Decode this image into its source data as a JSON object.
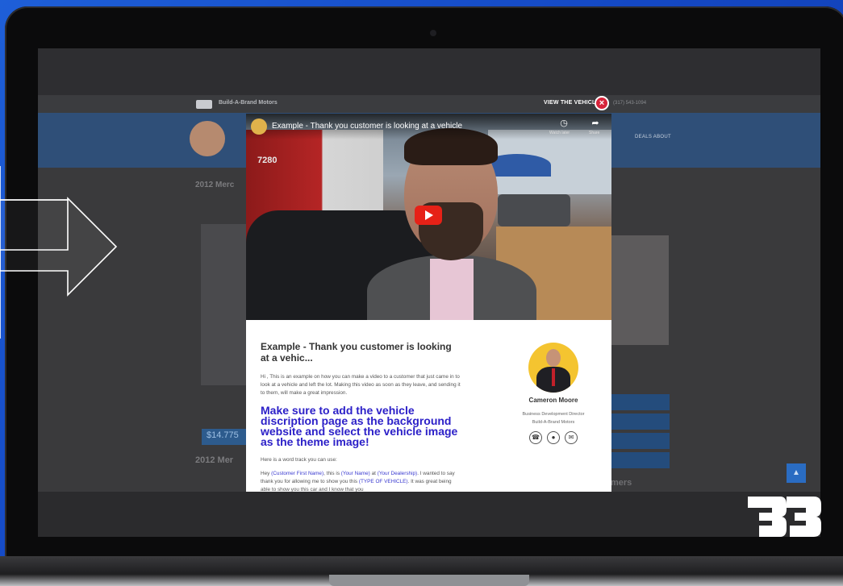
{
  "site": {
    "brand": "Build-A-Brand Motors",
    "page_heading": "2012 Merc",
    "price": "$14.775",
    "heading2": "2012 Mer",
    "nav": "DEALS   ABOUT",
    "phone": "(317) 543-1094",
    "view_vehicle": "VIEW THE VEHICLE",
    "sidebar_heading": "mers"
  },
  "video": {
    "title": "Example - Thank you customer is looking at a vehicle",
    "watch_later_label": "Watch later",
    "share_label": "Share",
    "sign_text": "7280"
  },
  "message": {
    "title": "Example - Thank you customer is looking at a vehic...",
    "body": "Hi , This is an example on how you can make a video to a customer that just came in to look at a vehicle and left the lot. Making this video as soon as they leave, and sending it to them, will make a great impression.",
    "instruction": "Make sure to add the vehicle discription page as the background website and select the vehicle image as the theme image!",
    "word_track_intro": "Here is a word track you can use:",
    "track_1": "Hey ",
    "var_first_name": "(Customer First Name)",
    "track_2": ", this is ",
    "var_your_name": "(Your Name)",
    "track_3": " at ",
    "var_dealership": "(Your Dealership)",
    "track_4": ". I wanted to say thank you for allowing me to show you this ",
    "var_vehicle": "(TYPE OF VEHICLE)",
    "track_5": ". It was great being able to show you this car and I know that you"
  },
  "contact_card": {
    "name": "Cameron Moore",
    "role": "Business Development Director",
    "company": "Build-A-Brand Motors",
    "icons": [
      "phone-icon",
      "chat-icon",
      "email-icon"
    ]
  },
  "colors": {
    "accent": "#2c20c8",
    "close": "#d6233a",
    "background": "#1e5fd8"
  }
}
